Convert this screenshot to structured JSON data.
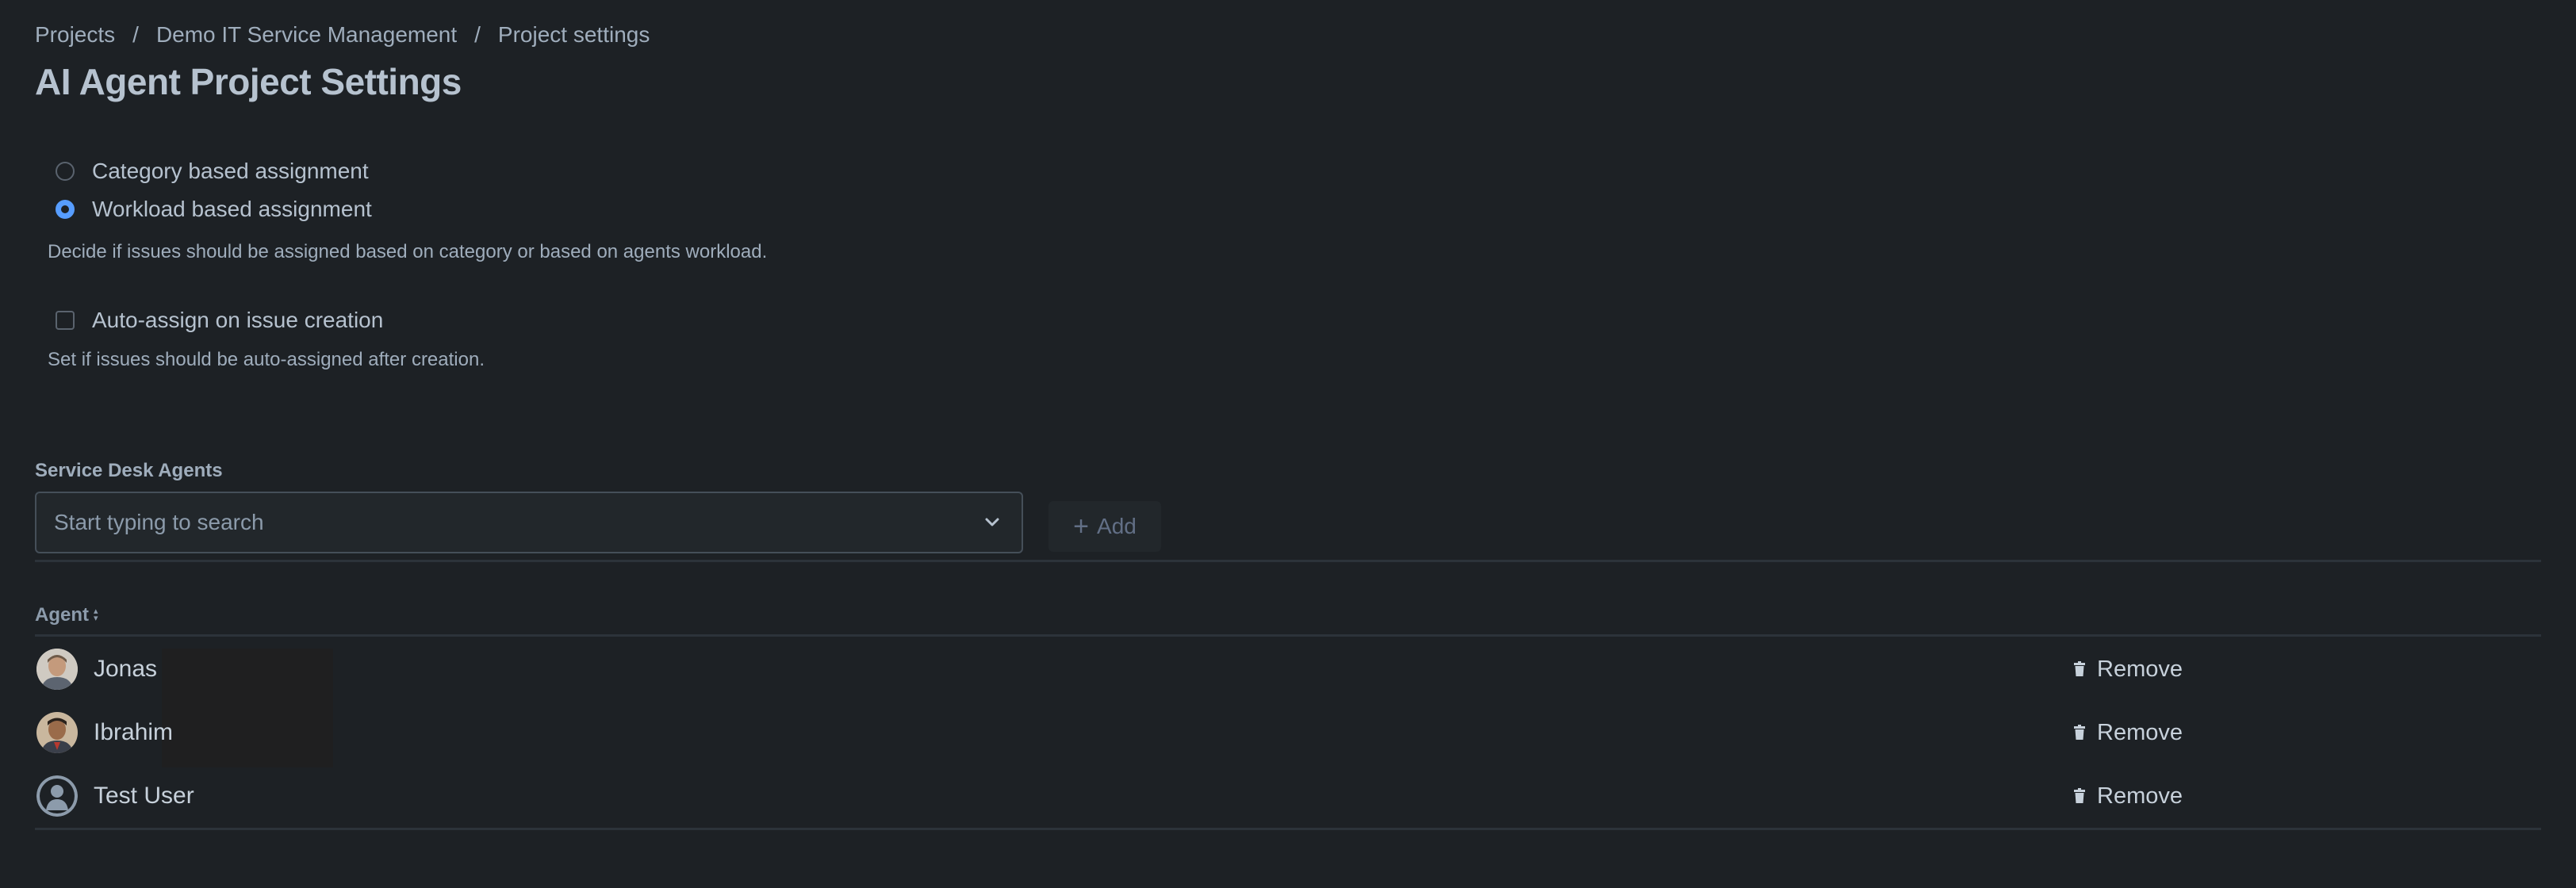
{
  "breadcrumb": {
    "items": [
      "Projects",
      "Demo IT Service Management",
      "Project settings"
    ],
    "separator": "/"
  },
  "page_title": "AI Agent Project Settings",
  "assignment": {
    "options": [
      {
        "label": "Category based assignment",
        "selected": false
      },
      {
        "label": "Workload based assignment",
        "selected": true
      }
    ],
    "help": "Decide if issues should be assigned based on category or based on agents workload."
  },
  "auto_assign": {
    "label": "Auto-assign on issue creation",
    "checked": false,
    "help": "Set if issues should be auto-assigned after creation."
  },
  "agents_section": {
    "label": "Service Desk Agents",
    "search_placeholder": "Start typing to search",
    "add_label": "Add",
    "table": {
      "column_header": "Agent",
      "rows": [
        {
          "name": "Jonas",
          "action": "Remove",
          "avatar": "photo-jonas"
        },
        {
          "name": "Ibrahim",
          "action": "Remove",
          "avatar": "photo-ibrahim"
        },
        {
          "name": "Test User",
          "action": "Remove",
          "avatar": "default-user"
        }
      ]
    }
  },
  "colors": {
    "background": "#1d2125",
    "accent": "#579dff",
    "text": "#b6c2cf",
    "muted": "#9fadbc"
  }
}
